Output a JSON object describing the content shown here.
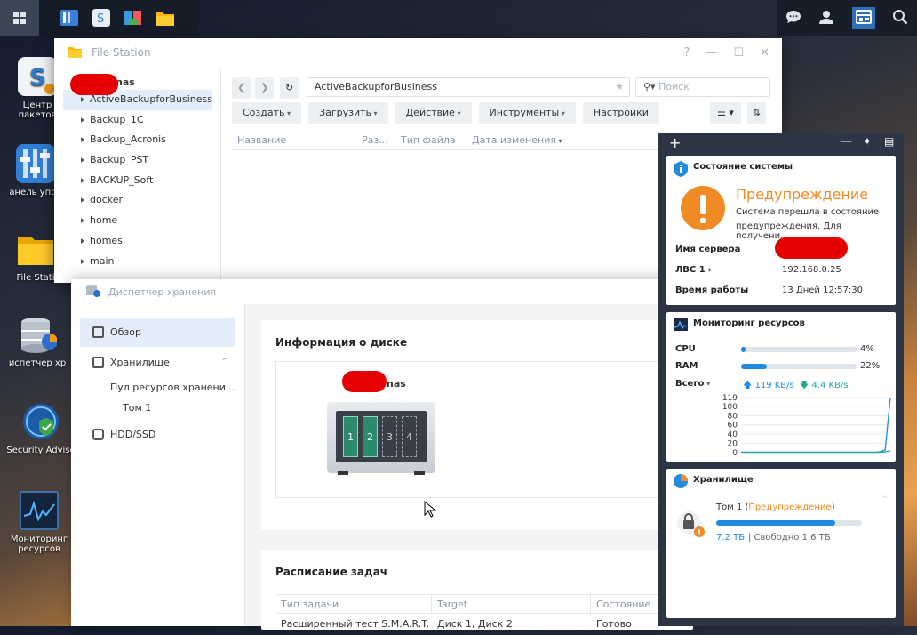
{
  "taskbar": {
    "left_icons": [
      "apps-icon",
      "storage-manager-icon",
      "package-center-icon",
      "file-station-icon",
      "folder-icon"
    ],
    "right_icons": [
      "chat-icon",
      "user-icon",
      "widgets-icon",
      "search-icon"
    ]
  },
  "desktop": [
    {
      "label": "Центр пакетов",
      "label_visible": "Центр\nпакетов",
      "icon": "package-center-icon"
    },
    {
      "label": "Панель управления",
      "label_visible": "анель упра",
      "icon": "control-panel-icon"
    },
    {
      "label": "File Station",
      "label_visible": "File Stati",
      "icon": "file-station-icon"
    },
    {
      "label": "Диспетчер хранения",
      "label_visible": "испетчер хр",
      "icon": "storage-manager-icon"
    },
    {
      "label": "Security Advisor",
      "label_visible": "Security Adviso",
      "icon": "security-advisor-icon"
    },
    {
      "label": "Мониторинг ресурсов",
      "label_visible": "Мониторинг\nресурсов",
      "icon": "resource-monitor-icon"
    }
  ],
  "file_station": {
    "title": "File Station",
    "root_label": "nas",
    "folders": [
      "ActiveBackupforBusiness",
      "Backup_1C",
      "Backup_Acronis",
      "Backup_PST",
      "BACKUP_Soft",
      "docker",
      "home",
      "homes",
      "main"
    ],
    "path": "ActiveBackupforBusiness",
    "search_placeholder": "Поиск",
    "toolbar": {
      "create": "Создать",
      "upload": "Загрузить",
      "action": "Действие",
      "tools": "Инструменты",
      "settings": "Настройки"
    },
    "columns": [
      "Название",
      "Раз...",
      "Тип файла",
      "Дата изменения"
    ],
    "window_controls": [
      "?",
      "—",
      "☐",
      "✕"
    ]
  },
  "storage_manager": {
    "title": "Диспетчер хранения",
    "nav": {
      "overview": "Обзор",
      "storage": "Хранилище",
      "pool": "Пул ресурсов хранени...",
      "volume": "Том 1",
      "hdd": "HDD/SSD"
    },
    "disk_info": {
      "title": "Информация о диске",
      "host": "nas",
      "slots": [
        "1",
        "2",
        "3",
        "4"
      ]
    },
    "schedule": {
      "title": "Расписание задач",
      "headers": [
        "Тип задачи",
        "Target",
        "Состояние"
      ],
      "rows": [
        [
          "Расширенный тест S.M.A.R.T.",
          "Диск 1, Диск 2",
          "Готово"
        ]
      ]
    }
  },
  "widgets": {
    "system": {
      "title": "Состояние системы",
      "status": "Предупреждение",
      "desc_line1": "Система перешла в состояние",
      "desc_line2": "предупреждения. Для получени...",
      "server_label": "Имя сервера",
      "lan_label": "ЛВС 1",
      "lan_value": "192.168.0.25",
      "uptime_label": "Время работы",
      "uptime_value": "13 Дней 12:57:30"
    },
    "resources": {
      "title": "Мониторинг ресурсов",
      "cpu_label": "CPU",
      "cpu_value": "4%",
      "cpu_pct": 4,
      "ram_label": "RAM",
      "ram_value": "22%",
      "ram_pct": 22,
      "total_label": "Всего",
      "up": "119 KB/s",
      "down": "4.4 KB/s"
    },
    "storage": {
      "title": "Хранилище",
      "volume_prefix": "Том 1 (",
      "volume_status": "Предупреждение",
      "volume_suffix": ")",
      "used": "7.2 ТБ",
      "free": "| Свободно 1.6 ТБ",
      "used_pct": 82
    }
  },
  "chart_data": {
    "type": "line",
    "title": "",
    "x": [
      0,
      1,
      2,
      3,
      4,
      5,
      6,
      7,
      8,
      9,
      10,
      11,
      12,
      13,
      14,
      15,
      16,
      17,
      18,
      19,
      20,
      21,
      22,
      23,
      24,
      25,
      26,
      27,
      28,
      29
    ],
    "series": [
      {
        "name": "",
        "values": [
          1,
          1,
          1,
          1,
          1,
          1,
          1,
          1,
          1,
          1,
          1,
          1,
          1,
          1,
          1,
          1,
          1,
          1,
          1,
          1,
          1,
          1,
          1,
          1,
          1,
          1,
          1,
          2,
          6,
          119
        ]
      },
      {
        "name": "",
        "values": [
          1,
          1,
          1,
          1,
          1,
          1,
          1,
          1,
          1,
          1,
          1,
          1,
          1,
          1,
          1,
          1,
          1,
          1,
          1,
          1,
          1,
          1,
          1,
          1,
          1,
          1,
          1,
          1,
          2,
          4
        ]
      }
    ],
    "yticks": [
      0,
      20,
      40,
      60,
      80,
      100,
      119
    ],
    "ylim": [
      0,
      119
    ],
    "grid": true,
    "colors": [
      "#1f8ae0",
      "#24a896"
    ]
  },
  "colors": {
    "accent": "#1f8ae0",
    "warning": "#f08a24",
    "widget_panel": "#2b3544"
  }
}
